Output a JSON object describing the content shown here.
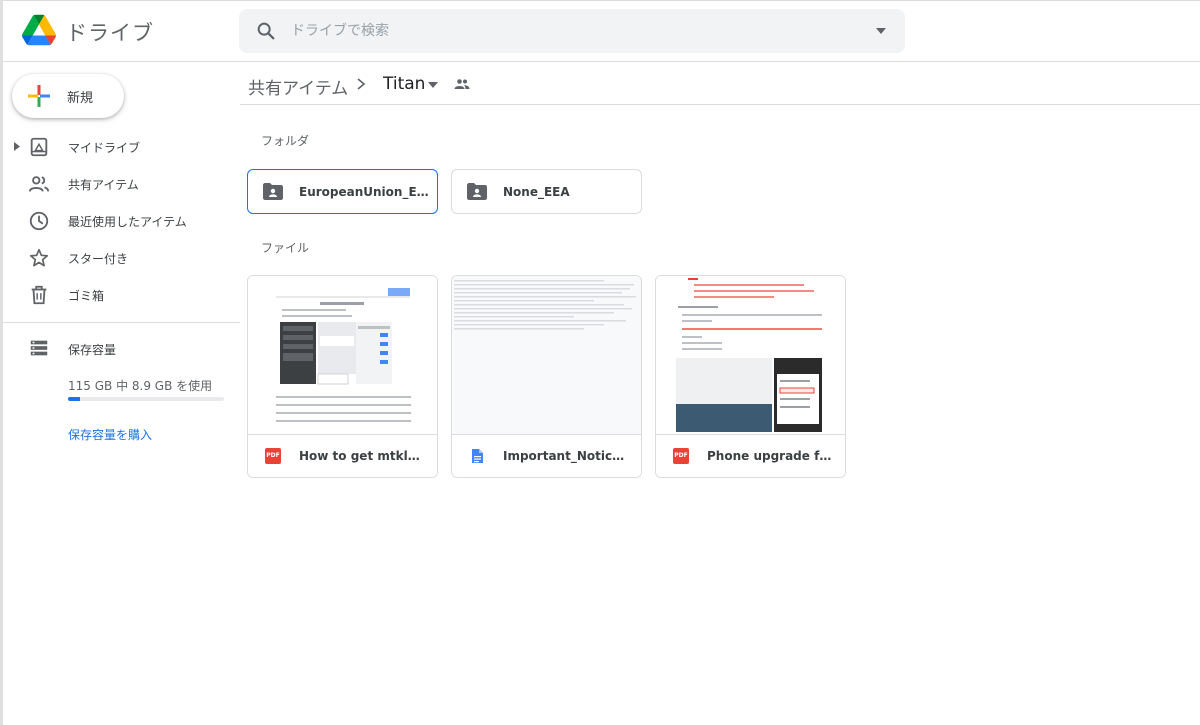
{
  "app": {
    "name": "ドライブ"
  },
  "search": {
    "placeholder": "ドライブで検索"
  },
  "sidebar": {
    "new_label": "新規",
    "items": [
      {
        "label": "マイドライブ",
        "icon": "my-drive-icon"
      },
      {
        "label": "共有アイテム",
        "icon": "shared-people-icon"
      },
      {
        "label": "最近使用したアイテム",
        "icon": "clock-icon"
      },
      {
        "label": "スター付き",
        "icon": "star-icon"
      },
      {
        "label": "ゴミ箱",
        "icon": "trash-icon"
      }
    ],
    "storage": {
      "title": "保存容量",
      "used": "115 GB 中 8.9 GB を使用",
      "fraction": 0.077,
      "buy": "保存容量を購入"
    }
  },
  "breadcrumb": {
    "root": "共有アイテム",
    "current": "Titan"
  },
  "sections": {
    "folders": "フォルダ",
    "files": "ファイル"
  },
  "folders": [
    {
      "name": "EuropeanUnion_EEA_...",
      "selected": true
    },
    {
      "name": "None_EEA",
      "selected": false
    }
  ],
  "files": [
    {
      "name": "How to get mtklog an...",
      "type": "pdf",
      "badge": "PDF"
    },
    {
      "name": "Important_Notice!!!!.txt",
      "type": "doc"
    },
    {
      "name": "Phone upgrade from I...",
      "type": "pdf",
      "badge": "PDF"
    }
  ],
  "colors": {
    "accent": "#1a73e8",
    "pdf": "#ea4335",
    "doc": "#4285f4"
  }
}
